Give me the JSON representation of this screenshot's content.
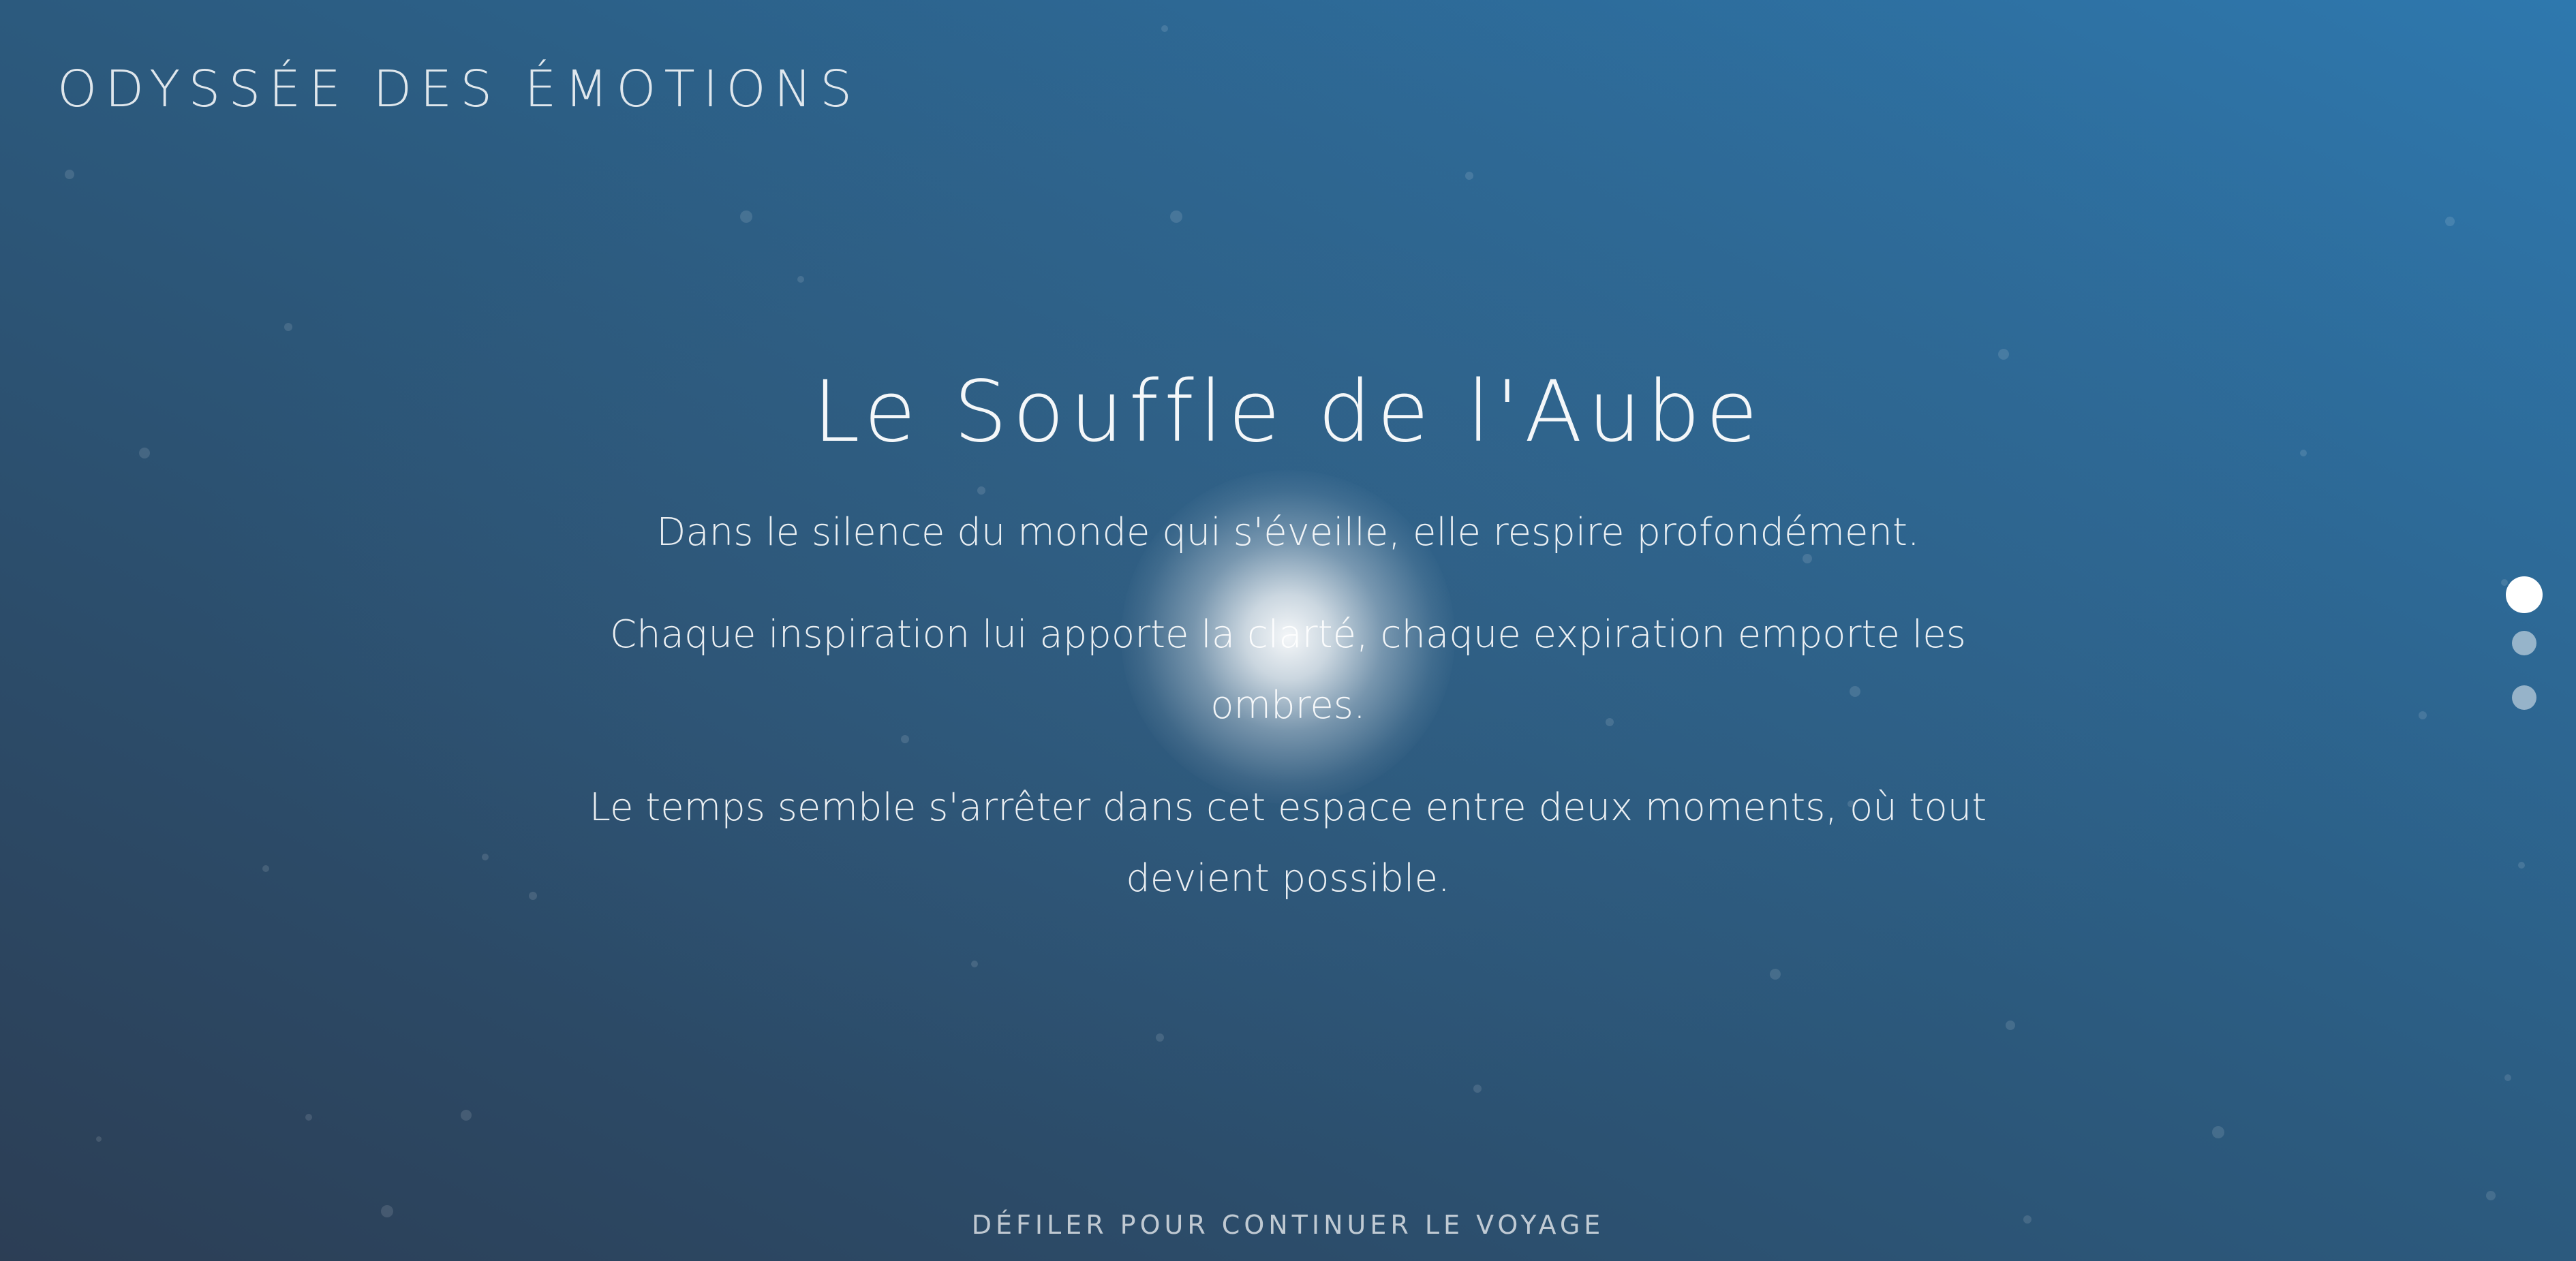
{
  "header": {
    "brand": "ODYSSÉE DES ÉMOTIONS"
  },
  "section": {
    "title": "Le Souffle de l'Aube",
    "paragraphs": [
      "Dans le silence du monde qui s'éveille, elle respire profondément.",
      "Chaque inspiration lui apporte la clarté, chaque expiration emporte les ombres.",
      "Le temps semble s'arrêter dans cet espace entre deux moments, où tout devient possible."
    ]
  },
  "navigation": {
    "dots": [
      {
        "state": "active"
      },
      {
        "state": "inactive"
      },
      {
        "state": "inactive"
      }
    ]
  },
  "footer": {
    "scroll_hint": "DÉFILER POUR CONTINUER LE VOYAGE"
  },
  "colors": {
    "background_start": "#2c3e55",
    "background_mid": "#2c5a7e",
    "background_end": "#2e78ae",
    "text": "#ffffff"
  }
}
